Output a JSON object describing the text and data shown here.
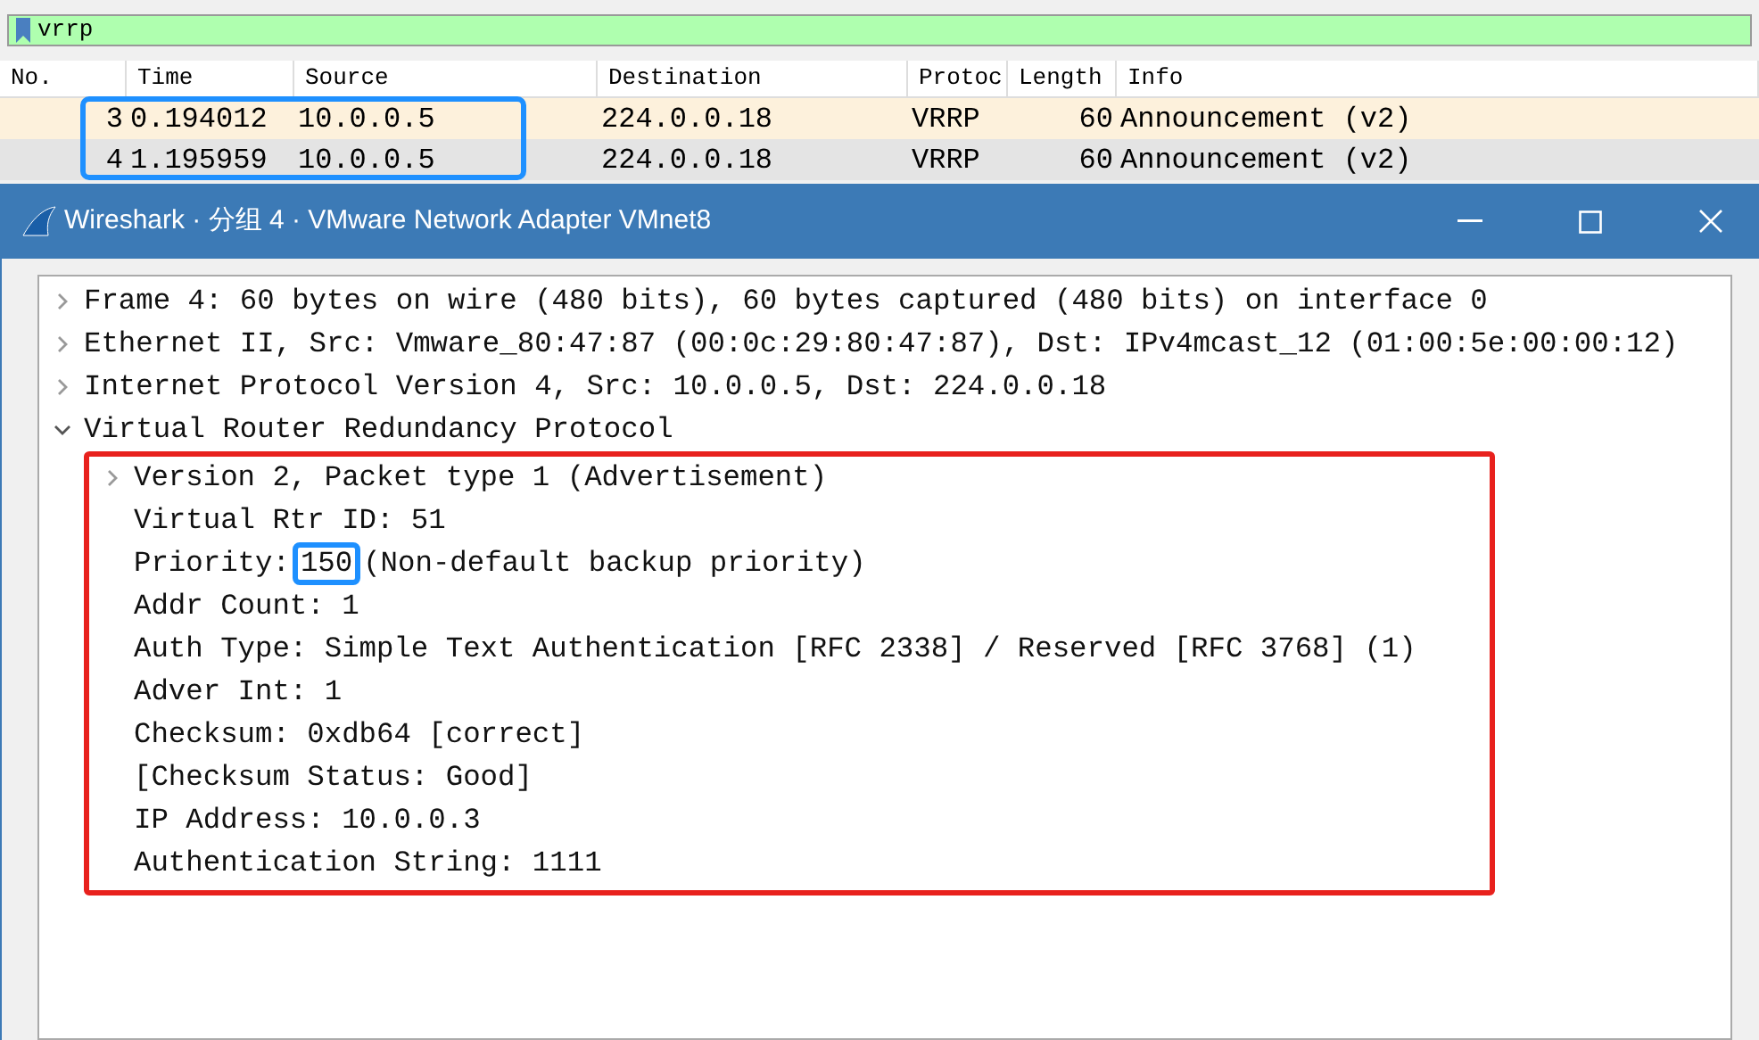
{
  "filter": {
    "value": "vrrp"
  },
  "packet_list": {
    "columns": [
      "No.",
      "Time",
      "Source",
      "Destination",
      "Protoc",
      "Length",
      "Info"
    ],
    "rows": [
      {
        "cells": [
          "3",
          "0.194012",
          "10.0.0.5",
          "224.0.0.18",
          "VRRP",
          "60",
          "Announcement (v2)"
        ],
        "selected": false
      },
      {
        "cells": [
          "4",
          "1.195959",
          "10.0.0.5",
          "224.0.0.18",
          "VRRP",
          "60",
          "Announcement (v2)"
        ],
        "selected": true
      }
    ]
  },
  "dialog": {
    "title": "Wireshark · 分组 4 · VMware Network Adapter VMnet8",
    "tree": [
      {
        "text": "Frame 4: 60 bytes on wire (480 bits), 60 bytes captured (480 bits) on interface 0",
        "expandable": true,
        "expanded": false
      },
      {
        "text": "Ethernet II, Src: Vmware_80:47:87 (00:0c:29:80:47:87), Dst: IPv4mcast_12 (01:00:5e:00:00:12)",
        "expandable": true,
        "expanded": false
      },
      {
        "text": "Internet Protocol Version 4, Src: 10.0.0.5, Dst: 224.0.0.18",
        "expandable": true,
        "expanded": false
      },
      {
        "text": "Virtual Router Redundancy Protocol",
        "expandable": true,
        "expanded": true,
        "children": [
          {
            "text": "Version 2, Packet type 1 (Advertisement)",
            "expandable": true,
            "expanded": false
          },
          {
            "text": "Virtual Rtr ID: 51",
            "expandable": false
          },
          {
            "text": "Priority:",
            "boxed": "150",
            "rest": "(Non-default backup priority)",
            "expandable": false
          },
          {
            "text": "Addr Count: 1",
            "expandable": false
          },
          {
            "text": "Auth Type: Simple Text Authentication [RFC 2338] / Reserved [RFC 3768] (1)",
            "expandable": false
          },
          {
            "text": "Adver Int: 1",
            "expandable": false
          },
          {
            "text": "Checksum: 0xdb64 [correct]",
            "expandable": false
          },
          {
            "text": "[Checksum Status: Good]",
            "expandable": false
          },
          {
            "text": "IP Address: 10.0.0.3",
            "expandable": false
          },
          {
            "text": "Authentication String: 1111",
            "expandable": false
          }
        ]
      }
    ]
  }
}
